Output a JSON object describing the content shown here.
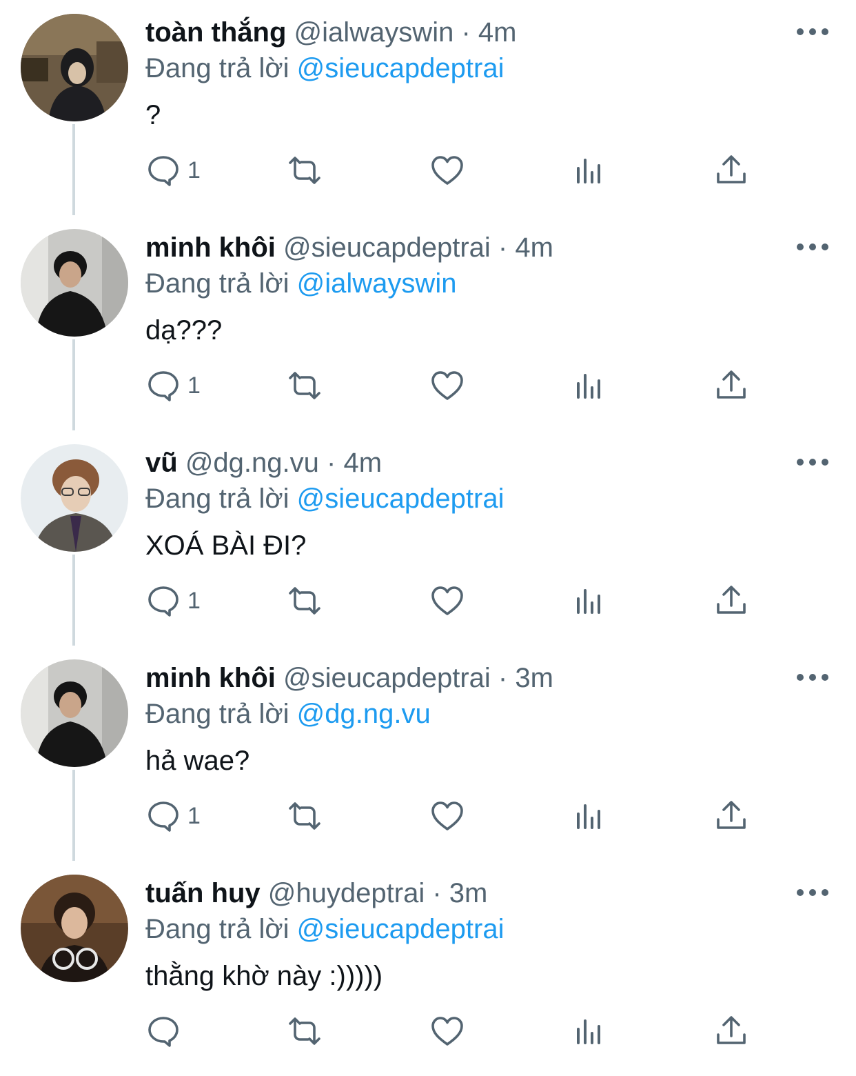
{
  "reply_prefix": "Đang trả lời",
  "icons": {
    "reply": "reply-icon",
    "retweet": "retweet-icon",
    "like": "heart-icon",
    "views": "analytics-icon",
    "share": "share-icon",
    "more": "more-icon"
  },
  "colors": {
    "text": "#0f1419",
    "secondary": "#536471",
    "link": "#1d9bf0",
    "thread_line": "#cfd9de"
  },
  "tweets": [
    {
      "name": "toàn thắng",
      "handle": "@ialwayswin",
      "separator": "·",
      "time": "4m",
      "reply_to": "@sieucapdeptrai",
      "text": "?",
      "reply_count": "1"
    },
    {
      "name": "minh khôi",
      "handle": "@sieucapdeptrai",
      "separator": "·",
      "time": "4m",
      "reply_to": "@ialwayswin",
      "text": "dạ???",
      "reply_count": "1"
    },
    {
      "name": "vũ",
      "handle": "@dg.ng.vu",
      "separator": "·",
      "time": "4m",
      "reply_to": "@sieucapdeptrai",
      "text": "XOÁ BÀI ĐI?",
      "reply_count": "1"
    },
    {
      "name": "minh khôi",
      "handle": "@sieucapdeptrai",
      "separator": "·",
      "time": "3m",
      "reply_to": "@dg.ng.vu",
      "text": "hả wae?",
      "reply_count": "1"
    },
    {
      "name": "tuấn huy",
      "handle": "@huydeptrai",
      "separator": "·",
      "time": "3m",
      "reply_to": "@sieucapdeptrai",
      "text": "thằng khờ này :)))))",
      "reply_count": ""
    }
  ]
}
